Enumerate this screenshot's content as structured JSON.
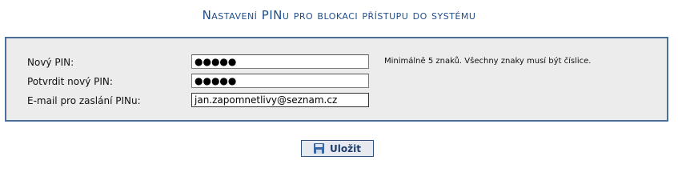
{
  "page_title": "Nastavení PINu pro blokaci přístupu do systému",
  "form": {
    "new_pin": {
      "label": "Nový PIN:",
      "value": "●●●●●"
    },
    "confirm_pin": {
      "label": "Potvrdit nový PIN:",
      "value": "●●●●●"
    },
    "email": {
      "label": "E-mail pro zaslání PINu:",
      "value": "jan.zapomnetlivy@seznam.cz"
    },
    "hint": "Minimálně 5 znaků. Všechny znaky musí být číslice."
  },
  "actions": {
    "save_label": "Uložit",
    "save_icon": "floppy-disk-icon"
  }
}
